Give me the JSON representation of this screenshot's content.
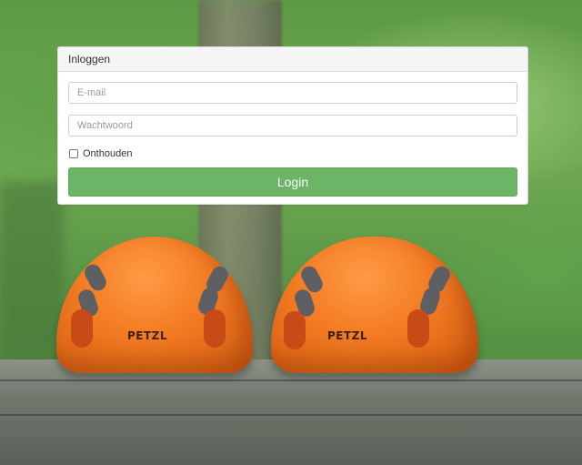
{
  "login": {
    "heading": "Inloggen",
    "email_placeholder": "E-mail",
    "password_placeholder": "Wachtwoord",
    "remember_label": "Onthouden",
    "submit_label": "Login"
  },
  "background": {
    "helmet_brand": "PETZL"
  },
  "colors": {
    "accent": "#6db566",
    "panel_heading_bg": "#f5f5f5",
    "panel_bg": "#ffffff"
  }
}
